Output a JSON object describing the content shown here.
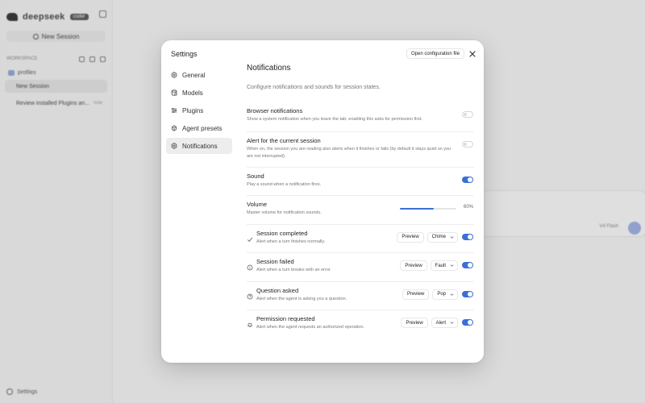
{
  "app": {
    "brand": "deepseek",
    "badge": "coder",
    "new_session": "New Session",
    "workspace_label": "WORKSPACE",
    "project": "profiles",
    "sessions": [
      {
        "label": "New Session",
        "meta": ""
      },
      {
        "label": "Review installed Plugins an...",
        "meta": "now"
      }
    ],
    "footer_settings": "Settings",
    "model_label": "V4 Flash"
  },
  "modal": {
    "title": "Settings",
    "open_config": "Open configuration file",
    "nav": [
      {
        "label": "General",
        "icon": "gear-icon"
      },
      {
        "label": "Models",
        "icon": "database-icon"
      },
      {
        "label": "Plugins",
        "icon": "sliders-icon"
      },
      {
        "label": "Agent presets",
        "icon": "agents-icon"
      },
      {
        "label": "Notifications",
        "icon": "gear-icon"
      }
    ],
    "active_nav": "Notifications"
  },
  "notifications": {
    "title": "Notifications",
    "description": "Configure notifications and sounds for session states.",
    "browser": {
      "title": "Browser notifications",
      "desc": "Show a system notification when you leave the tab; enabling this asks for permission first.",
      "enabled": false
    },
    "current_session": {
      "title": "Alert for the current session",
      "desc": "When on, the session you are reading also alerts when it finishes or fails (by default it stays quiet so you are not interrupted).",
      "enabled": false
    },
    "sound": {
      "title": "Sound",
      "desc": "Play a sound when a notification fires.",
      "enabled": true
    },
    "volume": {
      "title": "Volume",
      "desc": "Master volume for notification sounds.",
      "value": 60,
      "display": "60%"
    },
    "events": [
      {
        "title": "Session completed",
        "desc": "Alert when a turn finishes normally.",
        "icon": "check-icon",
        "preview": "Preview",
        "sound": "Chime",
        "enabled": true
      },
      {
        "title": "Session failed",
        "desc": "Alert when a turn breaks with an error.",
        "icon": "info-circle-icon",
        "preview": "Preview",
        "sound": "Fault",
        "enabled": true
      },
      {
        "title": "Question asked",
        "desc": "Alert when the agent is asking you a question.",
        "icon": "question-circle-icon",
        "preview": "Preview",
        "sound": "Pop",
        "enabled": true
      },
      {
        "title": "Permission requested",
        "desc": "Alert when the agent requests an authorized operation.",
        "icon": "bell-icon",
        "preview": "Preview",
        "sound": "Alert",
        "enabled": true
      }
    ]
  },
  "colors": {
    "accent": "#3b6fd6",
    "toggle_off": "#ffffff",
    "modal_bg": "#ffffff",
    "active_nav_bg": "#ededed"
  }
}
